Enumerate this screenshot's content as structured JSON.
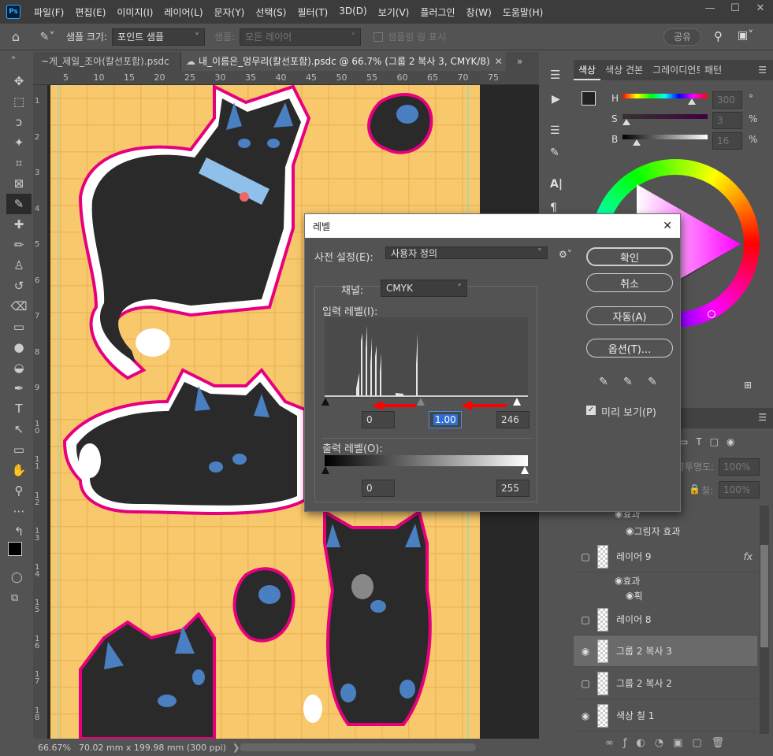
{
  "menubar": {
    "logo": "Ps",
    "items": [
      "파일(F)",
      "편집(E)",
      "이미지(I)",
      "레이어(L)",
      "문자(Y)",
      "선택(S)",
      "필터(T)",
      "3D(D)",
      "보기(V)",
      "플러그인",
      "창(W)",
      "도움말(H)"
    ]
  },
  "options": {
    "sample_size_label": "샘플 크기:",
    "sample_size_value": "포인트 샘플",
    "sample_label": "샘플:",
    "sample_value": "모든 레이어",
    "show_ring_label": "샘플링 링 표시",
    "share_label": "공유"
  },
  "tabs": [
    {
      "label": "~게_제일_조아(칼선포함).psdc"
    },
    {
      "label": "내_이름은_멍무리(칼선포함).psdc @ 66.7% (그룹 2 복사 3, CMYK/8)"
    }
  ],
  "ruler": {
    "h": [
      "5",
      "10",
      "15",
      "20",
      "25",
      "30",
      "35",
      "40",
      "45",
      "50",
      "55",
      "60",
      "65",
      "70",
      "75"
    ],
    "v": [
      "1",
      "2",
      "3",
      "4",
      "5",
      "6",
      "7",
      "8",
      "9",
      "10",
      "11",
      "12",
      "13",
      "14",
      "15",
      "16",
      "17",
      "18"
    ]
  },
  "status": {
    "zoom": "66.67%",
    "doc": "70.02 mm x 199.98 mm (300 ppi)"
  },
  "color_panel": {
    "tabs": [
      "색상",
      "색상 견본",
      "그레이디언트",
      "패턴"
    ],
    "h_label": "H",
    "h_value": "300",
    "h_unit": "°",
    "s_label": "S",
    "s_value": "3",
    "s_unit": "%",
    "b_label": "B",
    "b_value": "16",
    "b_unit": "%"
  },
  "layers_panel": {
    "opacity_label": "불투명도:",
    "opacity_value": "100%",
    "fill_label": "칠:",
    "fill_value": "100%",
    "items": [
      {
        "name": "효과",
        "kind": "effect-header"
      },
      {
        "name": "그림자 효과",
        "kind": "effect"
      },
      {
        "name": "레이어 9",
        "kind": "layer",
        "fx": "fx"
      },
      {
        "name": "효과",
        "kind": "effect-header"
      },
      {
        "name": "획",
        "kind": "effect"
      },
      {
        "name": "레이어 8",
        "kind": "layer"
      },
      {
        "name": "그룹 2 복사 3",
        "kind": "layer",
        "selected": true
      },
      {
        "name": "그룹 2 복사 2",
        "kind": "layer"
      },
      {
        "name": "색상 칠 1",
        "kind": "layer"
      }
    ]
  },
  "dialog": {
    "title": "레벨",
    "preset_label": "사전 설정(E):",
    "preset_value": "사용자 정의",
    "channel_label": "채널:",
    "channel_value": "CMYK",
    "input_label": "입력 레벨(I):",
    "input_black": "0",
    "input_mid": "1.00",
    "input_white": "246",
    "output_label": "출력 레벨(O):",
    "output_black": "0",
    "output_white": "255",
    "ok": "확인",
    "cancel": "취소",
    "auto": "자동(A)",
    "options": "옵션(T)...",
    "preview": "미리 보기(P)",
    "colors": {
      "accent": "#ff0000",
      "bg": "#535353"
    }
  }
}
